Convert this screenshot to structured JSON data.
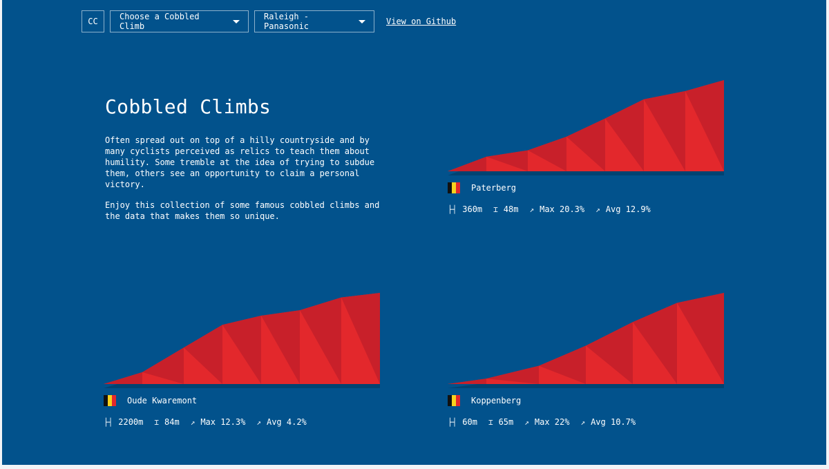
{
  "nav": {
    "logo": "CC",
    "climb_select": "Choose a Cobbled Climb",
    "team_select": "Raleigh - Panasonic",
    "github_link": "View on Github"
  },
  "intro": {
    "title": "Cobbled Climbs",
    "p1": "Often spread out on top of a hilly countryside and by many cyclists perceived as relics to teach them about humility. Some tremble at the idea of trying to subdue them, others see an opportunity to claim a personal victory.",
    "p2": "Enjoy this collection of some famous cobbled climbs and the data that makes them so unique."
  },
  "colors": {
    "background": "#02528c",
    "profile_light": "#e3282c",
    "profile_dark": "#c8202a",
    "flag_black": "#111111",
    "flag_yellow": "#f7d21e",
    "flag_red": "#e3282c"
  },
  "icons": {
    "distance": "horizontal-range-icon",
    "elevation": "vertical-range-icon",
    "gradient": "arrow-up-right-icon"
  },
  "climbs": [
    {
      "name": "Paterberg",
      "distance": "360m",
      "elevation": "48m",
      "max": "Max 20.3%",
      "avg": "Avg 12.9%",
      "profile": [
        [
          0,
          0
        ],
        [
          0.14,
          0.16
        ],
        [
          0.29,
          0.23
        ],
        [
          0.43,
          0.38
        ],
        [
          0.57,
          0.58
        ],
        [
          0.71,
          0.79
        ],
        [
          0.86,
          0.88
        ],
        [
          1,
          1
        ]
      ]
    },
    {
      "name": "Oude Kwaremont",
      "distance": "2200m",
      "elevation": "84m",
      "max": "Max 12.3%",
      "avg": "Avg 4.2%",
      "profile": [
        [
          0,
          0
        ],
        [
          0.14,
          0.13
        ],
        [
          0.29,
          0.4
        ],
        [
          0.43,
          0.65
        ],
        [
          0.57,
          0.75
        ],
        [
          0.71,
          0.81
        ],
        [
          0.86,
          0.95
        ],
        [
          1,
          1
        ]
      ]
    },
    {
      "name": "Koppenberg",
      "distance": "60m",
      "elevation": "65m",
      "max": "Max 22%",
      "avg": "Avg 10.7%",
      "profile": [
        [
          0,
          0
        ],
        [
          0.14,
          0.06
        ],
        [
          0.33,
          0.2
        ],
        [
          0.5,
          0.42
        ],
        [
          0.67,
          0.68
        ],
        [
          0.83,
          0.89
        ],
        [
          1,
          1
        ]
      ]
    }
  ]
}
